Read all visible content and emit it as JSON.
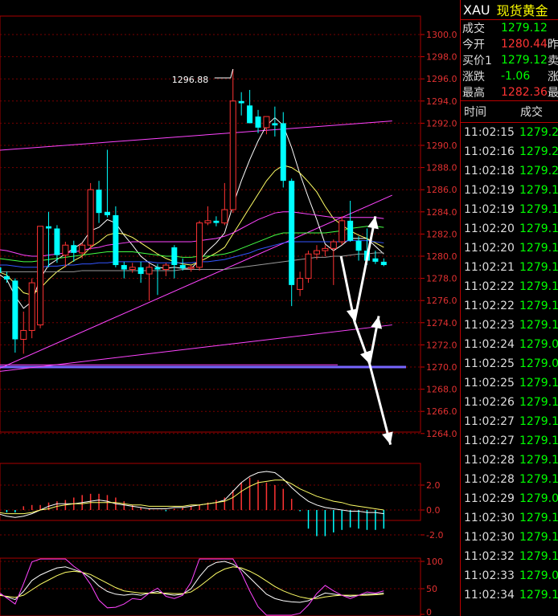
{
  "quote": {
    "symbol": "XAU",
    "name": "现货黄金",
    "rows": [
      {
        "label": "成交",
        "value": "1279.12",
        "color": "#00ff00",
        "extra": ""
      },
      {
        "label": "今开",
        "value": "1280.44",
        "color": "#ff3333",
        "extra": "昨"
      },
      {
        "label": "买价1",
        "value": "1279.12",
        "color": "#00ff00",
        "extra": "卖"
      },
      {
        "label": "涨跌",
        "value": "-1.06",
        "color": "#00ff00",
        "extra": "涨"
      },
      {
        "label": "最高",
        "value": "1282.36",
        "color": "#ff3333",
        "extra": "最"
      }
    ],
    "col_time": "时间",
    "col_price": "成交"
  },
  "ticks": [
    {
      "t": "11:02:15",
      "p": "1279.2"
    },
    {
      "t": "11:02:16",
      "p": "1279.2"
    },
    {
      "t": "11:02:18",
      "p": "1279.2"
    },
    {
      "t": "11:02:19",
      "p": "1279.1"
    },
    {
      "t": "11:02:19",
      "p": "1279.1"
    },
    {
      "t": "11:02:20",
      "p": "1279.1"
    },
    {
      "t": "11:02:20",
      "p": "1279.1"
    },
    {
      "t": "11:02:21",
      "p": "1279.1"
    },
    {
      "t": "11:02:22",
      "p": "1279.1"
    },
    {
      "t": "11:02:22",
      "p": "1279.1"
    },
    {
      "t": "11:02:23",
      "p": "1279.1"
    },
    {
      "t": "11:02:24",
      "p": "1279.0"
    },
    {
      "t": "11:02:25",
      "p": "1279.0"
    },
    {
      "t": "11:02:25",
      "p": "1279.1"
    },
    {
      "t": "11:02:26",
      "p": "1279.1"
    },
    {
      "t": "11:02:27",
      "p": "1279.1"
    },
    {
      "t": "11:02:27",
      "p": "1279.1"
    },
    {
      "t": "11:02:28",
      "p": "1279.1"
    },
    {
      "t": "11:02:28",
      "p": "1279.1"
    },
    {
      "t": "11:02:29",
      "p": "1279.0"
    },
    {
      "t": "11:02:30",
      "p": "1279.1"
    },
    {
      "t": "11:02:30",
      "p": "1279.1"
    },
    {
      "t": "11:02:32",
      "p": "1279.1"
    },
    {
      "t": "11:02:33",
      "p": "1279.0"
    },
    {
      "t": "11:02:34",
      "p": "1279.1"
    }
  ],
  "chart_data": [
    {
      "type": "candlestick",
      "ylim": [
        1262.5,
        1300.8
      ],
      "yticks": [
        "1300.0",
        "1298.0",
        "1296.0",
        "1294.0",
        "1292.0",
        "1290.0",
        "1288.0",
        "1286.0",
        "1284.0",
        "1282.0",
        "1280.0",
        "1278.0",
        "1276.0",
        "1274.0",
        "1272.0",
        "1270.0",
        "1268.0",
        "1266.0",
        "1264.0"
      ],
      "annotation": {
        "text": "1296.88",
        "value": 1296.88,
        "index": 28
      },
      "colors": {
        "up": "#ff3333",
        "down": "#00ffff"
      },
      "candles": [
        {
          "o": 1279.0,
          "h": 1279.6,
          "l": 1277.5,
          "c": 1278.5
        },
        {
          "o": 1278.2,
          "h": 1278.6,
          "l": 1277.6,
          "c": 1277.9
        },
        {
          "o": 1277.8,
          "h": 1278.0,
          "l": 1271.3,
          "c": 1272.5
        },
        {
          "o": 1272.5,
          "h": 1275.0,
          "l": 1271.2,
          "c": 1273.3
        },
        {
          "o": 1273.3,
          "h": 1278.0,
          "l": 1272.6,
          "c": 1277.6
        },
        {
          "o": 1273.8,
          "h": 1280.5,
          "l": 1273.5,
          "c": 1282.7
        },
        {
          "o": 1282.7,
          "h": 1284.0,
          "l": 1279.0,
          "c": 1282.5
        },
        {
          "o": 1282.5,
          "h": 1282.8,
          "l": 1279.4,
          "c": 1280.1
        },
        {
          "o": 1280.1,
          "h": 1281.3,
          "l": 1279.0,
          "c": 1281.0
        },
        {
          "o": 1281.0,
          "h": 1281.4,
          "l": 1279.5,
          "c": 1280.3
        },
        {
          "o": 1280.3,
          "h": 1281.2,
          "l": 1279.8,
          "c": 1281.0
        },
        {
          "o": 1281.0,
          "h": 1286.6,
          "l": 1280.6,
          "c": 1286.0
        },
        {
          "o": 1286.0,
          "h": 1286.8,
          "l": 1283.0,
          "c": 1283.9
        },
        {
          "o": 1284.0,
          "h": 1289.6,
          "l": 1283.5,
          "c": 1283.7
        },
        {
          "o": 1283.7,
          "h": 1284.5,
          "l": 1279.0,
          "c": 1279.2
        },
        {
          "o": 1279.2,
          "h": 1279.5,
          "l": 1278.0,
          "c": 1278.8
        },
        {
          "o": 1278.8,
          "h": 1279.4,
          "l": 1278.5,
          "c": 1279.0
        },
        {
          "o": 1279.0,
          "h": 1279.5,
          "l": 1277.6,
          "c": 1278.4
        },
        {
          "o": 1278.4,
          "h": 1279.3,
          "l": 1276.0,
          "c": 1279.0
        },
        {
          "o": 1279.0,
          "h": 1279.3,
          "l": 1276.5,
          "c": 1278.8
        },
        {
          "o": 1278.8,
          "h": 1279.4,
          "l": 1278.2,
          "c": 1279.2
        },
        {
          "o": 1280.8,
          "h": 1281.0,
          "l": 1278.0,
          "c": 1279.2
        },
        {
          "o": 1279.2,
          "h": 1279.8,
          "l": 1278.7,
          "c": 1278.9
        },
        {
          "o": 1278.9,
          "h": 1279.2,
          "l": 1278.6,
          "c": 1279.0
        },
        {
          "o": 1279.0,
          "h": 1283.2,
          "l": 1278.7,
          "c": 1283.0
        },
        {
          "o": 1283.0,
          "h": 1284.5,
          "l": 1282.8,
          "c": 1283.2
        },
        {
          "o": 1283.2,
          "h": 1283.6,
          "l": 1282.7,
          "c": 1283.0
        },
        {
          "o": 1283.0,
          "h": 1286.6,
          "l": 1282.8,
          "c": 1284.2
        },
        {
          "o": 1284.2,
          "h": 1296.88,
          "l": 1283.9,
          "c": 1294.0
        },
        {
          "o": 1294.0,
          "h": 1294.8,
          "l": 1292.7,
          "c": 1293.8
        },
        {
          "o": 1293.6,
          "h": 1295.0,
          "l": 1292.0,
          "c": 1292.0
        },
        {
          "o": 1292.6,
          "h": 1293.2,
          "l": 1291.1,
          "c": 1291.6
        },
        {
          "o": 1291.6,
          "h": 1292.5,
          "l": 1291.0,
          "c": 1292.6
        },
        {
          "o": 1292.0,
          "h": 1293.5,
          "l": 1290.8,
          "c": 1291.8
        },
        {
          "o": 1292.0,
          "h": 1293.0,
          "l": 1286.2,
          "c": 1286.8
        },
        {
          "o": 1286.8,
          "h": 1287.0,
          "l": 1275.5,
          "c": 1277.4
        },
        {
          "o": 1277.0,
          "h": 1278.6,
          "l": 1276.4,
          "c": 1278.0
        },
        {
          "o": 1278.0,
          "h": 1280.5,
          "l": 1277.6,
          "c": 1280.2
        },
        {
          "o": 1280.2,
          "h": 1281.0,
          "l": 1279.7,
          "c": 1280.5
        },
        {
          "o": 1280.5,
          "h": 1281.0,
          "l": 1280.0,
          "c": 1280.7
        },
        {
          "o": 1280.7,
          "h": 1281.5,
          "l": 1277.4,
          "c": 1281.3
        },
        {
          "o": 1281.3,
          "h": 1283.6,
          "l": 1281.0,
          "c": 1283.2
        },
        {
          "o": 1283.2,
          "h": 1285.0,
          "l": 1281.3,
          "c": 1281.4
        },
        {
          "o": 1281.4,
          "h": 1281.8,
          "l": 1279.6,
          "c": 1280.5
        },
        {
          "o": 1280.5,
          "h": 1282.5,
          "l": 1279.2,
          "c": 1279.6
        },
        {
          "o": 1279.8,
          "h": 1280.5,
          "l": 1279.3,
          "c": 1279.5
        },
        {
          "o": 1279.5,
          "h": 1279.8,
          "l": 1279.1,
          "c": 1279.2
        }
      ],
      "series": [
        {
          "color": "#ffffff",
          "values": [
            1278.4,
            1277.9,
            1276.4,
            1275.3,
            1275.9,
            1278.0,
            1279.2,
            1279.7,
            1280.2,
            1280.7,
            1281.2,
            1282.3,
            1282.6,
            1283.3,
            1283.0,
            1281.9,
            1281.0,
            1280.0,
            1279.4,
            1279.0,
            1278.9,
            1279.0,
            1278.9,
            1278.9,
            1279.6,
            1280.5,
            1281.2,
            1282.1,
            1284.6,
            1286.8,
            1288.7,
            1290.4,
            1291.8,
            1292.5,
            1291.8,
            1289.8,
            1287.4,
            1285.3,
            1283.3,
            1281.1,
            1280.5,
            1281.0,
            1281.6,
            1281.6,
            1281.6,
            1280.9,
            1280.2
          ]
        },
        {
          "color": "#ffff66",
          "values": [
            1278.6,
            1278.3,
            1277.5,
            1276.7,
            1276.5,
            1277.1,
            1277.9,
            1278.6,
            1279.1,
            1279.6,
            1280.0,
            1280.8,
            1281.3,
            1281.9,
            1282.1,
            1282.0,
            1281.7,
            1281.2,
            1280.7,
            1280.2,
            1279.8,
            1279.5,
            1279.3,
            1279.2,
            1279.5,
            1279.9,
            1280.3,
            1280.8,
            1282.0,
            1283.2,
            1284.4,
            1285.6,
            1286.8,
            1287.7,
            1288.2,
            1288.0,
            1287.5,
            1286.7,
            1285.8,
            1284.5,
            1283.4,
            1282.8,
            1282.3,
            1281.9,
            1281.6,
            1281.2,
            1280.8
          ]
        },
        {
          "color": "#ff44ff",
          "values": [
            1280.6,
            1280.5,
            1280.3,
            1280.1,
            1280.0,
            1280.0,
            1280.1,
            1280.2,
            1280.3,
            1280.4,
            1280.5,
            1280.7,
            1280.8,
            1281.0,
            1281.1,
            1281.2,
            1281.3,
            1281.3,
            1281.3,
            1281.3,
            1281.3,
            1281.3,
            1281.3,
            1281.3,
            1281.4,
            1281.5,
            1281.6,
            1281.8,
            1282.1,
            1282.5,
            1282.9,
            1283.3,
            1283.6,
            1283.9,
            1284.0,
            1284.0,
            1283.9,
            1283.8,
            1283.7,
            1283.6,
            1283.5,
            1283.5,
            1283.5,
            1283.5,
            1283.5,
            1283.5,
            1283.4
          ]
        },
        {
          "color": "#44ff44",
          "values": [
            1279.8,
            1279.7,
            1279.6,
            1279.5,
            1279.5,
            1279.6,
            1279.7,
            1279.8,
            1279.9,
            1280.0,
            1280.1,
            1280.2,
            1280.3,
            1280.4,
            1280.4,
            1280.4,
            1280.4,
            1280.3,
            1280.2,
            1280.1,
            1280.0,
            1280.0,
            1279.9,
            1279.9,
            1280.0,
            1280.0,
            1280.1,
            1280.2,
            1280.4,
            1280.7,
            1281.0,
            1281.3,
            1281.6,
            1281.9,
            1282.1,
            1282.1,
            1282.1,
            1282.1,
            1282.1,
            1282.1,
            1282.2,
            1282.3,
            1282.5,
            1282.6,
            1282.7,
            1282.7,
            1282.6
          ]
        },
        {
          "color": "#3355ff",
          "values": [
            1279.2,
            1279.2,
            1279.1,
            1279.0,
            1279.0,
            1279.0,
            1279.1,
            1279.1,
            1279.2,
            1279.2,
            1279.3,
            1279.3,
            1279.4,
            1279.4,
            1279.5,
            1279.5,
            1279.5,
            1279.5,
            1279.5,
            1279.4,
            1279.4,
            1279.4,
            1279.4,
            1279.4,
            1279.5,
            1279.5,
            1279.6,
            1279.7,
            1279.9,
            1280.1,
            1280.3,
            1280.6,
            1280.8,
            1281.0,
            1281.2,
            1281.3,
            1281.3,
            1281.3,
            1281.3,
            1281.3,
            1281.3,
            1281.3,
            1281.4,
            1281.4,
            1281.4,
            1281.3,
            1281.2
          ]
        },
        {
          "color": "#999999",
          "values": [
            1278.6,
            1278.6,
            1278.6,
            1278.6,
            1278.6,
            1278.6,
            1278.6,
            1278.6,
            1278.6,
            1278.6,
            1278.7,
            1278.7,
            1278.7,
            1278.7,
            1278.7,
            1278.7,
            1278.7,
            1278.7,
            1278.7,
            1278.7,
            1278.7,
            1278.7,
            1278.8,
            1278.8,
            1278.8,
            1278.8,
            1278.8,
            1278.8,
            1278.9,
            1279.0,
            1279.1,
            1279.2,
            1279.3,
            1279.4,
            1279.5,
            1279.6,
            1279.7,
            1279.8,
            1279.9,
            1279.9,
            1280.0,
            1280.0,
            1280.1,
            1280.2,
            1280.2,
            1280.3,
            1280.3
          ]
        }
      ],
      "trendlines": [
        {
          "color": "#ff44ff",
          "from": [
            -1,
            1289.5
          ],
          "to": [
            47,
            1292.2
          ]
        },
        {
          "color": "#ff44ff",
          "from": [
            -1,
            1269.5
          ],
          "to": [
            47,
            1285.5
          ]
        },
        {
          "color": "#ff44ff",
          "from": [
            -1,
            1269.5
          ],
          "to": [
            47,
            1273.8
          ]
        },
        {
          "color": "#ff44ff",
          "from": [
            -1,
            1270.2
          ],
          "to": [
            40.5,
            1270.2
          ]
        }
      ],
      "hline": {
        "value": 1270.0,
        "color": "#7766ff"
      },
      "arrows": [
        {
          "from": [
            40.9,
            1280.0
          ],
          "to": [
            42.5,
            1274.1
          ]
        },
        {
          "from": [
            42.5,
            1274.1
          ],
          "to": [
            45,
            1283.6
          ]
        },
        {
          "from": [
            42.5,
            1274.1
          ],
          "to": [
            44.3,
            1270.3
          ]
        },
        {
          "from": [
            44.3,
            1270.3
          ],
          "to": [
            45.4,
            1274.6
          ]
        },
        {
          "from": [
            44.3,
            1270.3
          ],
          "to": [
            46.8,
            1263.0
          ]
        }
      ]
    },
    {
      "type": "bar",
      "ylim": [
        -2.4,
        3.0
      ],
      "yticks": [
        "2.0",
        "0.0",
        "-2.0"
      ],
      "hist": [
        -0.1,
        -0.2,
        -0.2,
        0.3,
        0.4,
        0.4,
        0.6,
        0.7,
        0.8,
        1.0,
        1.2,
        1.3,
        1.3,
        1.2,
        1.0,
        0.7,
        0.4,
        0.2,
        0.1,
        0.0,
        -0.1,
        0.1,
        0.2,
        0.3,
        0.4,
        0.6,
        0.8,
        1.0,
        1.6,
        2.2,
        2.6,
        2.4,
        2.2,
        2.0,
        1.7,
        0.9,
        -0.1,
        -1.5,
        -2.1,
        -2.1,
        -1.8,
        -1.6,
        -1.4,
        -1.5,
        -1.6,
        -1.6,
        -1.5
      ],
      "dif": [
        -0.3,
        -0.5,
        -0.6,
        -0.5,
        -0.3,
        0.0,
        0.3,
        0.5,
        0.5,
        0.5,
        0.6,
        0.7,
        0.8,
        0.7,
        0.5,
        0.4,
        0.3,
        0.2,
        0.1,
        0.1,
        0.1,
        0.2,
        0.2,
        0.3,
        0.4,
        0.5,
        0.6,
        0.8,
        1.5,
        2.2,
        2.7,
        3.0,
        3.1,
        3.0,
        2.5,
        1.8,
        1.2,
        0.7,
        0.4,
        0.2,
        0.1,
        0.0,
        -0.1,
        -0.1,
        -0.2,
        -0.2,
        -0.3
      ],
      "dea": [
        -0.2,
        -0.3,
        -0.3,
        -0.3,
        -0.2,
        0.0,
        0.1,
        0.3,
        0.4,
        0.5,
        0.5,
        0.6,
        0.6,
        0.6,
        0.6,
        0.5,
        0.4,
        0.4,
        0.3,
        0.3,
        0.3,
        0.3,
        0.3,
        0.4,
        0.4,
        0.5,
        0.6,
        0.7,
        1.0,
        1.5,
        1.9,
        2.2,
        2.3,
        2.4,
        2.4,
        2.1,
        1.7,
        1.4,
        1.1,
        0.9,
        0.7,
        0.6,
        0.4,
        0.3,
        0.2,
        0.1,
        0.0
      ]
    },
    {
      "type": "line",
      "ylim": [
        0,
        110
      ],
      "yticks": [
        "100",
        "50",
        "0"
      ],
      "k": [
        40,
        35,
        30,
        45,
        65,
        75,
        82,
        88,
        90,
        85,
        80,
        70,
        55,
        45,
        40,
        38,
        40,
        38,
        42,
        45,
        40,
        38,
        40,
        50,
        72,
        90,
        98,
        100,
        95,
        85,
        70,
        55,
        40,
        32,
        28,
        26,
        25,
        28,
        35,
        42,
        40,
        38,
        36,
        38,
        40,
        40,
        42
      ],
      "d": [
        38,
        36,
        34,
        38,
        48,
        58,
        66,
        74,
        80,
        82,
        80,
        76,
        68,
        60,
        52,
        46,
        44,
        42,
        42,
        42,
        42,
        41,
        41,
        44,
        54,
        66,
        78,
        86,
        90,
        88,
        82,
        74,
        64,
        54,
        46,
        40,
        35,
        32,
        32,
        35,
        37,
        38,
        38,
        38,
        38,
        39,
        40
      ],
      "j": [
        44,
        33,
        22,
        59,
        99,
        109,
        114,
        116,
        110,
        91,
        80,
        58,
        29,
        15,
        16,
        22,
        32,
        30,
        42,
        51,
        36,
        32,
        38,
        62,
        108,
        138,
        138,
        128,
        105,
        79,
        46,
        17,
        -8,
        -12,
        -8,
        -2,
        5,
        20,
        41,
        56,
        46,
        38,
        32,
        38,
        44,
        42,
        46
      ]
    }
  ]
}
